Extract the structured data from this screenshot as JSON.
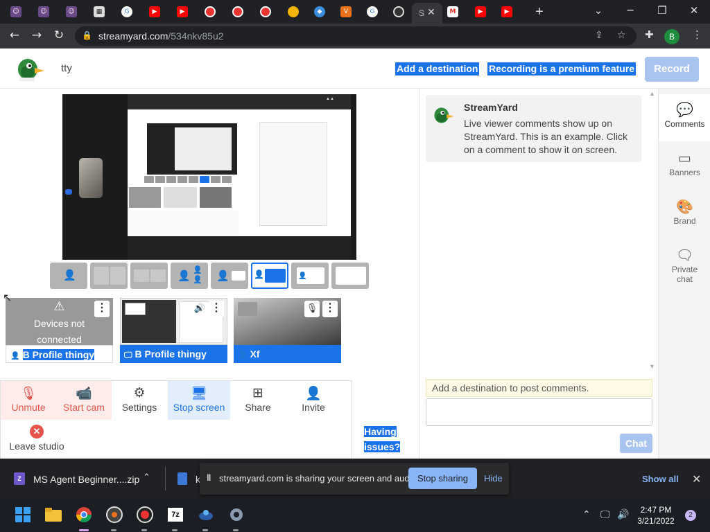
{
  "browser": {
    "active_tab_label": "S",
    "url_host": "streamyard.com",
    "url_path": "/534nkv85u2",
    "profile_initial": "B",
    "icons": [
      "back-icon",
      "forward-icon",
      "reload-icon",
      "lock-icon",
      "share-icon",
      "star-icon",
      "extensions-icon",
      "kebab-menu-icon"
    ]
  },
  "studio": {
    "title": "tty",
    "add_destination": "Add a destination",
    "recording_premium": "Recording is a premium feature",
    "record": "Record"
  },
  "participants": [
    {
      "status_line1": "Devices not",
      "status_line2": "connected",
      "name": "B Profile thingy"
    },
    {
      "name": "B Profile thingy"
    },
    {
      "name": "Xf"
    }
  ],
  "controls": {
    "unmute": "Unmute",
    "start_cam": "Start cam",
    "settings": "Settings",
    "stop_screen": "Stop screen",
    "share": "Share",
    "invite": "Invite",
    "leave": "Leave studio"
  },
  "help": {
    "line1": "Having",
    "line2": "issues?"
  },
  "chat": {
    "author": "StreamYard",
    "message": "Live viewer comments show up on StreamYard. This is an example. Click on a comment to show it on screen.",
    "destination_note": "Add a destination to post comments.",
    "send": "Chat"
  },
  "side_tabs": {
    "comments": "Comments",
    "banners": "Banners",
    "brand": "Brand",
    "private_chat_1": "Private",
    "private_chat_2": "chat"
  },
  "downloads": {
    "file1": "MS Agent Beginner....zip",
    "file2": "k",
    "show_all": "Show all",
    "file1_icon_text": "Z"
  },
  "share_notice": {
    "message": "streamyard.com is sharing your screen and audio.",
    "stop": "Stop sharing",
    "hide": "Hide"
  },
  "taskbar": {
    "time": "2:47 PM",
    "date": "3/21/2022",
    "notifications": "2",
    "app_7z": "7z"
  },
  "colors": {
    "accent": "#1a73e8",
    "danger": "#e5534b",
    "disabled_button": "#a9c4ee"
  }
}
